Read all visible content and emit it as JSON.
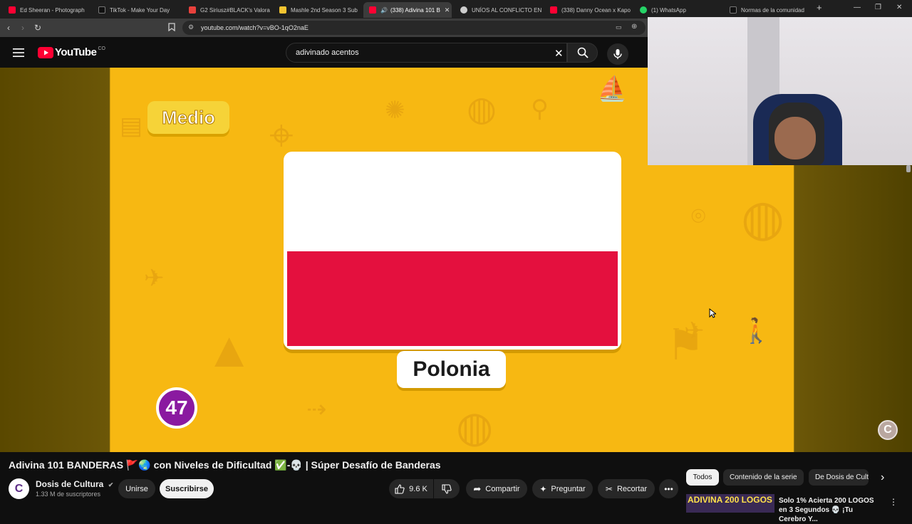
{
  "browser": {
    "tabs": [
      {
        "title": "Ed Sheeran - Photograph",
        "favicon_color": "#ff0033",
        "active": false
      },
      {
        "title": "TikTok - Make Your Day",
        "favicon_color": "#111111",
        "active": false
      },
      {
        "title": "G2 Siriusz#BLACK's Valora",
        "favicon_color": "#e8413c",
        "active": false
      },
      {
        "title": "Mashle 2nd Season 3 Sub",
        "favicon_color": "#f4c430",
        "active": false
      },
      {
        "title": "(338) Adivina 101 B",
        "favicon_color": "#ff0033",
        "active": true
      },
      {
        "title": "UNÍOS AL CONFLICTO EN",
        "favicon_color": "#cccccc",
        "active": false
      },
      {
        "title": "(338) Danny Ocean x Kapo",
        "favicon_color": "#ff0033",
        "active": false
      },
      {
        "title": "(1) WhatsApp",
        "favicon_color": "#25d366",
        "active": false
      },
      {
        "title": "Normas de la comunidad",
        "favicon_color": "#111111",
        "active": false
      }
    ],
    "new_tab_icon": "plus-icon",
    "url": "youtube.com/watch?v=vBO-1qO2naE"
  },
  "youtube": {
    "logo_text": "YouTube",
    "region": "CO",
    "search_query": "adivinado acentos",
    "brand_color": "#ff0033"
  },
  "video": {
    "difficulty_badge": "Medio",
    "country_name": "Polonia",
    "question_number": "47",
    "flag_colors": [
      "#ffffff",
      "#e4103e"
    ],
    "watermark": "C",
    "title": "Adivina 101 BANDERAS 🚩🌏 con Niveles de Dificultad ✅-💀 | Súper Desafío de Banderas"
  },
  "channel": {
    "avatar_letter": "C",
    "name": "Dosis de Cultura",
    "subscribers": "1.33 M de suscriptores",
    "join_label": "Unirse",
    "subscribe_label": "Suscribirse"
  },
  "actions": {
    "likes": "9.6 K",
    "share": "Compartir",
    "ask": "Preguntar",
    "clip": "Recortar"
  },
  "chips": [
    "Todos",
    "Contenido de la serie",
    "De Dosis de Cultura"
  ],
  "recommendation": {
    "thumb_text": "ADIVINA 200 LOGOS",
    "title": "Solo 1% Acierta 200 LOGOS en 3 Segundos 💀 ¡Tu Cerebro Y..."
  }
}
